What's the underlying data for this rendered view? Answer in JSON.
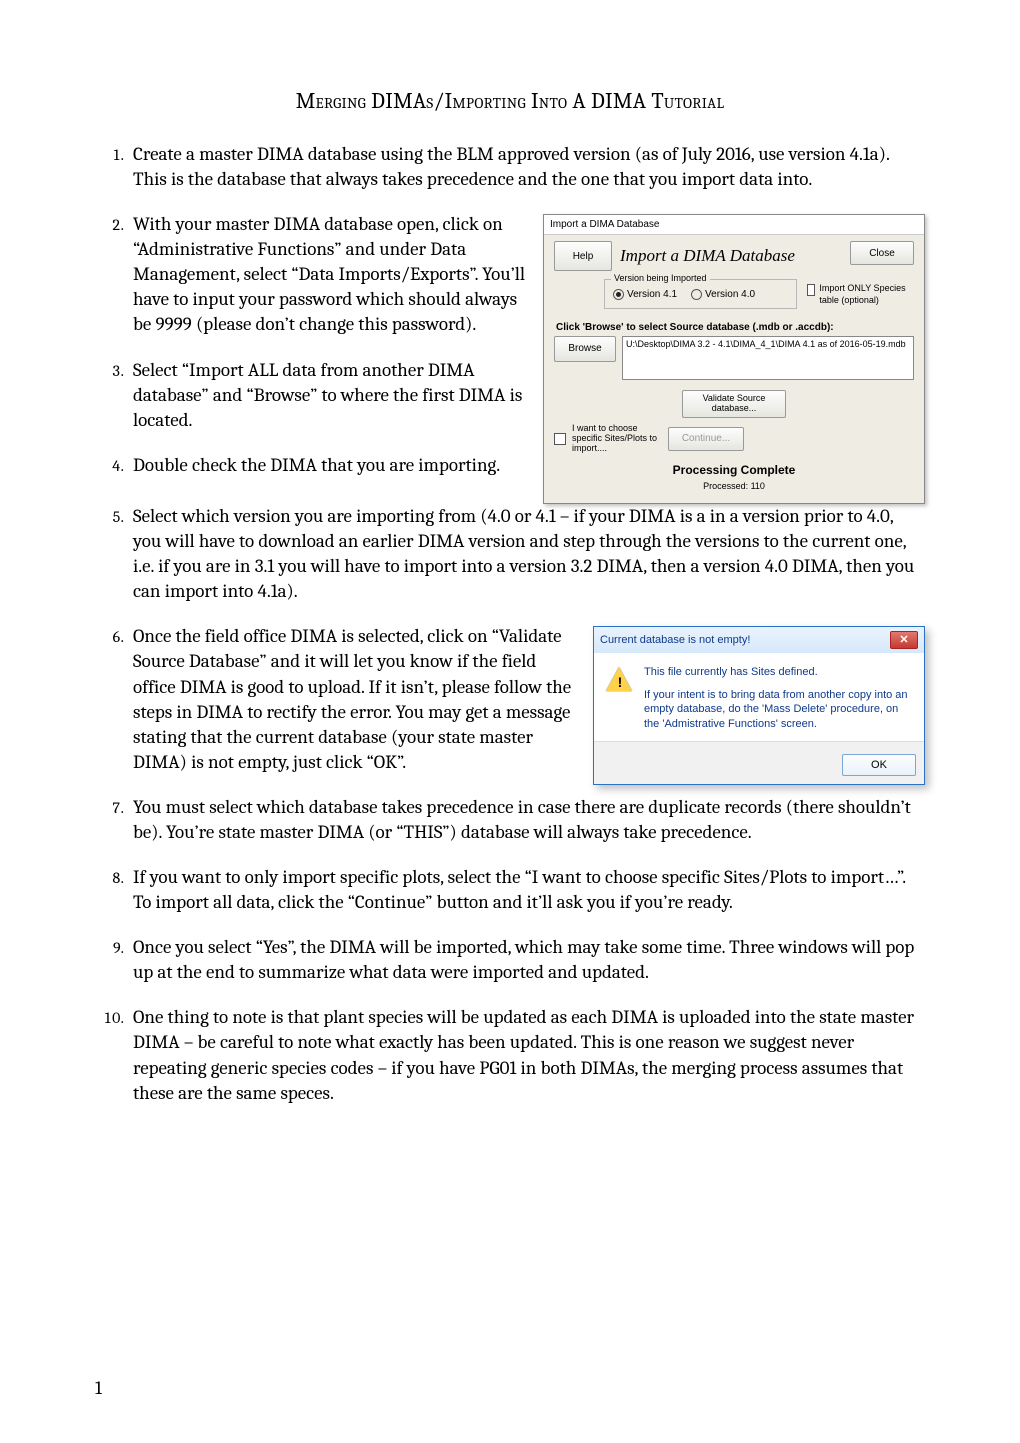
{
  "title": "Merging DIMAs/Importing Into A DIMA Tutorial",
  "pageNumber": "1",
  "items": {
    "i1": "Create a master DIMA database using the BLM approved version (as of July 2016, use version 4.1a). This is the database that always takes precedence and the one that you import data into.",
    "i2": "With your master DIMA database open, click on “Administrative Functions” and under Data Management, select “Data Imports/Exports”. You’ll have to input your password which should always be 9999 (please don’t change this password).",
    "i3": "Select “Import ALL data from another DIMA database” and “Browse” to where the first DIMA is located.",
    "i4": "Double check the DIMA that you are importing.",
    "i5": "Select which version you are importing from (4.0 or 4.1 – if your DIMA is a in a version prior to 4.0, you will have to download an earlier DIMA version and step through the versions to the current one, i.e. if you are in 3.1 you will have to import into a version 3.2 DIMA, then a version 4.0 DIMA, then you can import into 4.1a).",
    "i6a": "Once the field office DIMA is selected, click on “Validate Source Database” and it will let you know if the field office DIMA is good to upload. If it isn’t, please follow the steps in DIMA to rectify the error. You may get a message stating that the current database (your state master DIMA) is ",
    "i6word": "not",
    "i6b": " empty, just click “OK”.",
    "i7": "You must select which database takes precedence in case there are duplicate records (there shouldn’t be). You’re state master DIMA (or “THIS”) database will always take precedence.",
    "i8": "If you want to only import specific plots, select the “I want to choose specific Sites/Plots to import…”. To import all data, click the “Continue” button and it’ll ask you if you’re ready.",
    "i9": "Once you select “Yes”, the DIMA will be imported, which may take some time. Three windows will pop up at the end to summarize what data were imported and updated.",
    "i10": "One thing to note is that plant species will be updated as each DIMA is uploaded into the state master DIMA – be careful to note what exactly has been updated.  This is one reason we suggest never repeating generic species codes – if you have PG01 in both DIMAs, the merging process assumes that these are the same speces."
  },
  "dialog": {
    "windowTitle": "Import a DIMA Database",
    "help": "Help",
    "heading": "Import a DIMA Database",
    "close": "Close",
    "versionLegend": "Version being Imported",
    "radio41": "Version 4.1",
    "radio40": "Version 4.0",
    "importSpeciesLabel": "Import ONLY Species table (optional)",
    "browsePrompt": "Click 'Browse' to select Source database (.mdb or .accdb):",
    "browse": "Browse",
    "path": "U:\\Desktop\\DIMA 3.2 - 4.1\\DIMA_4_1\\DIMA 4.1 as of 2016-05-19.mdb",
    "validate": "Validate Source database...",
    "chooseLabel": "I want to choose specific Sites/Plots to import....",
    "continue": "Continue...",
    "processingComplete": "Processing Complete",
    "processed": "Processed: 110"
  },
  "msgbox": {
    "title": "Current database is not empty!",
    "line1": "This file currently has Sites defined.",
    "line2": "If your intent is to bring data from another copy into an empty database, do the 'Mass Delete' procedure, on the 'Admistrative Functions' screen.",
    "ok": "OK"
  }
}
